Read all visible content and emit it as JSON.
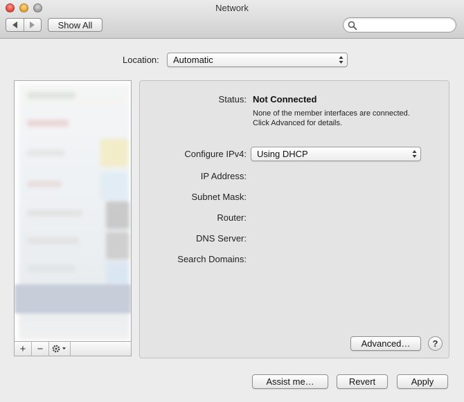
{
  "window": {
    "title": "Network"
  },
  "toolbar": {
    "show_all_label": "Show All",
    "search_placeholder": ""
  },
  "location": {
    "label": "Location:",
    "value": "Automatic"
  },
  "service_list": {
    "add_label": "+",
    "remove_label": "−"
  },
  "details": {
    "status_label": "Status:",
    "status_value": "Not Connected",
    "status_detail": "None of the member interfaces are connected. Click Advanced for details.",
    "configure_ipv4_label": "Configure IPv4:",
    "configure_ipv4_value": "Using DHCP",
    "ip_address_label": "IP Address:",
    "subnet_mask_label": "Subnet Mask:",
    "router_label": "Router:",
    "dns_server_label": "DNS Server:",
    "search_domains_label": "Search Domains:",
    "advanced_label": "Advanced…",
    "help_label": "?"
  },
  "footer": {
    "assist_label": "Assist me…",
    "revert_label": "Revert",
    "apply_label": "Apply"
  },
  "colors": {
    "window_bg": "#ececec",
    "panel_bg": "#e4e4e4",
    "selection": "#c7cdd9"
  }
}
